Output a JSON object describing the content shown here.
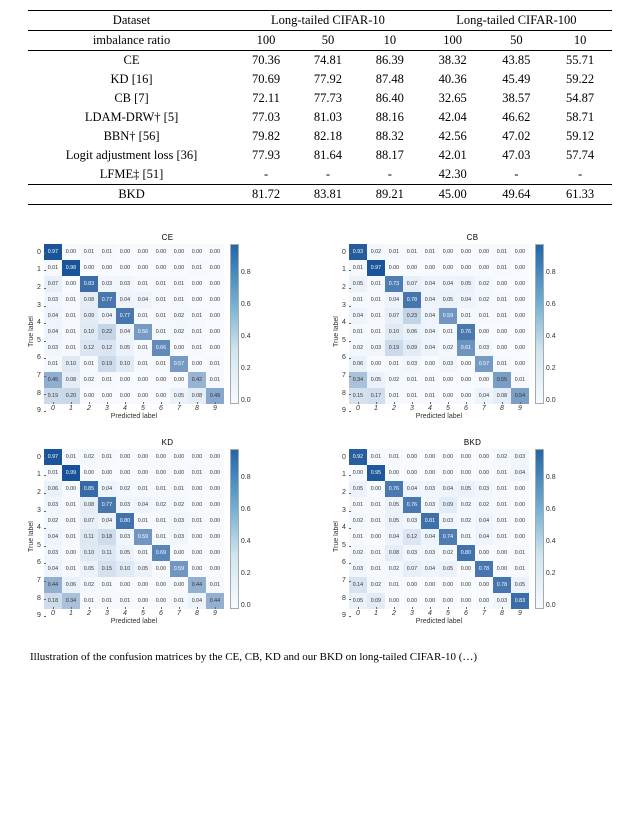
{
  "table": {
    "header1": {
      "dataset": "Dataset",
      "g10": "Long-tailed CIFAR-10",
      "g100": "Long-tailed CIFAR-100"
    },
    "header2": {
      "imb": "imbalance ratio",
      "c": [
        "100",
        "50",
        "10",
        "100",
        "50",
        "10"
      ]
    },
    "rows": [
      {
        "name": "CE",
        "v": [
          "70.36",
          "74.81",
          "86.39",
          "38.32",
          "43.85",
          "55.71"
        ]
      },
      {
        "name": "KD [16]",
        "v": [
          "70.69",
          "77.92",
          "87.48",
          "40.36",
          "45.49",
          "59.22"
        ]
      },
      {
        "name": "CB [7]",
        "v": [
          "72.11",
          "77.73",
          "86.40",
          "32.65",
          "38.57",
          "54.87"
        ]
      },
      {
        "name": "LDAM-DRW† [5]",
        "v": [
          "77.03",
          "81.03",
          "88.16",
          "42.04",
          "46.62",
          "58.71"
        ]
      },
      {
        "name": "BBN† [56]",
        "v": [
          "79.82",
          "82.18",
          "88.32",
          "42.56",
          "47.02",
          "59.12"
        ]
      },
      {
        "name": "Logit adjustment loss [36]",
        "v": [
          "77.93",
          "81.64",
          "88.17",
          "42.01",
          "47.03",
          "57.74"
        ]
      },
      {
        "name": "LFME‡ [51]",
        "v": [
          "-",
          "-",
          "-",
          "42.30",
          "-",
          "-"
        ]
      }
    ],
    "bkd": {
      "name": "BKD",
      "v": [
        "81.72",
        "83.81",
        "89.21",
        "45.00",
        "49.64",
        "61.33"
      ]
    }
  },
  "axis": {
    "ylabel": "True label",
    "xlabel": "Predicted label",
    "ticks": [
      "0",
      "1",
      "2",
      "3",
      "4",
      "5",
      "6",
      "7",
      "8",
      "9"
    ],
    "cbar_ticks_top": "",
    "cbar": [
      "",
      "0.8",
      "0.6",
      "0.4",
      "0.2",
      "0.0"
    ]
  },
  "chart_data": [
    {
      "type": "heatmap",
      "title": "CE",
      "xlabel": "Predicted label",
      "ylabel": "True label",
      "categories": [
        "0",
        "1",
        "2",
        "3",
        "4",
        "5",
        "6",
        "7",
        "8",
        "9"
      ],
      "values": [
        [
          0.97,
          0.0,
          0.01,
          0.01,
          0.0,
          0.0,
          0.0,
          0.0,
          0.0,
          0.0
        ],
        [
          0.01,
          0.98,
          0.0,
          0.0,
          0.0,
          0.0,
          0.0,
          0.0,
          0.01,
          0.0
        ],
        [
          0.07,
          0.0,
          0.83,
          0.03,
          0.03,
          0.01,
          0.01,
          0.01,
          0.0,
          0.0
        ],
        [
          0.03,
          0.01,
          0.08,
          0.77,
          0.04,
          0.04,
          0.01,
          0.01,
          0.0,
          0.0
        ],
        [
          0.04,
          0.01,
          0.09,
          0.04,
          0.77,
          0.01,
          0.01,
          0.02,
          0.01,
          0.0
        ],
        [
          0.04,
          0.01,
          0.1,
          0.22,
          0.04,
          0.56,
          0.01,
          0.02,
          0.01,
          0.0
        ],
        [
          0.03,
          0.01,
          0.12,
          0.12,
          0.05,
          0.01,
          0.66,
          0.0,
          0.01,
          0.0
        ],
        [
          0.01,
          0.1,
          0.01,
          0.19,
          0.1,
          0.01,
          0.01,
          0.57,
          0.0,
          0.01
        ],
        [
          0.45,
          0.08,
          0.02,
          0.01,
          0.0,
          0.0,
          0.0,
          0.0,
          0.42,
          0.01
        ],
        [
          0.19,
          0.2,
          0.0,
          0.0,
          0.0,
          0.0,
          0.0,
          0.05,
          0.08,
          0.49
        ]
      ]
    },
    {
      "type": "heatmap",
      "title": "CB",
      "xlabel": "Predicted label",
      "ylabel": "True label",
      "categories": [
        "0",
        "1",
        "2",
        "3",
        "4",
        "5",
        "6",
        "7",
        "8",
        "9"
      ],
      "values": [
        [
          0.93,
          0.02,
          0.01,
          0.01,
          0.01,
          0.0,
          0.0,
          0.0,
          0.01,
          0.0
        ],
        [
          0.01,
          0.97,
          0.0,
          0.0,
          0.0,
          0.0,
          0.0,
          0.0,
          0.01,
          0.0
        ],
        [
          0.05,
          0.01,
          0.73,
          0.07,
          0.04,
          0.04,
          0.05,
          0.02,
          0.0,
          0.0
        ],
        [
          0.01,
          0.01,
          0.04,
          0.78,
          0.04,
          0.05,
          0.04,
          0.02,
          0.01,
          0.0
        ],
        [
          0.04,
          0.01,
          0.07,
          0.23,
          0.04,
          0.59,
          0.01,
          0.01,
          0.01,
          0.0
        ],
        [
          0.01,
          0.01,
          0.1,
          0.06,
          0.04,
          0.01,
          0.76,
          0.0,
          0.0,
          0.0
        ],
        [
          0.02,
          0.03,
          0.19,
          0.09,
          0.04,
          0.02,
          0.61,
          0.03,
          0.0,
          0.0
        ],
        [
          0.06,
          0.0,
          0.01,
          0.03,
          0.0,
          0.03,
          0.0,
          0.57,
          0.01,
          0.0
        ],
        [
          0.34,
          0.05,
          0.02,
          0.01,
          0.01,
          0.0,
          0.0,
          0.0,
          0.55,
          0.01
        ],
        [
          0.15,
          0.17,
          0.01,
          0.01,
          0.01,
          0.0,
          0.0,
          0.04,
          0.08,
          0.54
        ]
      ]
    },
    {
      "type": "heatmap",
      "title": "KD",
      "xlabel": "Predicted label",
      "ylabel": "True label",
      "categories": [
        "0",
        "1",
        "2",
        "3",
        "4",
        "5",
        "6",
        "7",
        "8",
        "9"
      ],
      "values": [
        [
          0.97,
          0.01,
          0.02,
          0.01,
          0.0,
          0.0,
          0.0,
          0.0,
          0.0,
          0.0
        ],
        [
          0.01,
          0.99,
          0.0,
          0.0,
          0.0,
          0.0,
          0.0,
          0.0,
          0.01,
          0.0
        ],
        [
          0.06,
          0.0,
          0.85,
          0.04,
          0.02,
          0.01,
          0.01,
          0.01,
          0.0,
          0.0
        ],
        [
          0.03,
          0.01,
          0.08,
          0.77,
          0.03,
          0.04,
          0.02,
          0.02,
          0.0,
          0.0
        ],
        [
          0.02,
          0.01,
          0.07,
          0.04,
          0.8,
          0.01,
          0.01,
          0.03,
          0.01,
          0.0
        ],
        [
          0.04,
          0.01,
          0.11,
          0.18,
          0.03,
          0.59,
          0.01,
          0.03,
          0.0,
          0.0
        ],
        [
          0.03,
          0.0,
          0.1,
          0.11,
          0.05,
          0.01,
          0.69,
          0.0,
          0.0,
          0.0
        ],
        [
          0.04,
          0.01,
          0.05,
          0.15,
          0.1,
          0.05,
          0.0,
          0.59,
          0.0,
          0.0
        ],
        [
          0.44,
          0.06,
          0.02,
          0.01,
          0.0,
          0.0,
          0.0,
          0.0,
          0.44,
          0.01
        ],
        [
          0.18,
          0.34,
          0.01,
          0.01,
          0.01,
          0.0,
          0.0,
          0.01,
          0.04,
          0.44
        ]
      ]
    },
    {
      "type": "heatmap",
      "title": "BKD",
      "xlabel": "Predicted label",
      "ylabel": "True label",
      "categories": [
        "0",
        "1",
        "2",
        "3",
        "4",
        "5",
        "6",
        "7",
        "8",
        "9"
      ],
      "values": [
        [
          0.92,
          0.01,
          0.01,
          0.0,
          0.0,
          0.0,
          0.0,
          0.0,
          0.02,
          0.03
        ],
        [
          0.0,
          0.95,
          0.0,
          0.0,
          0.0,
          0.0,
          0.0,
          0.0,
          0.01,
          0.04
        ],
        [
          0.05,
          0.0,
          0.76,
          0.04,
          0.03,
          0.04,
          0.05,
          0.03,
          0.01,
          0.0
        ],
        [
          0.01,
          0.01,
          0.05,
          0.76,
          0.03,
          0.09,
          0.02,
          0.02,
          0.01,
          0.0
        ],
        [
          0.02,
          0.01,
          0.05,
          0.03,
          0.81,
          0.03,
          0.02,
          0.04,
          0.01,
          0.0
        ],
        [
          0.01,
          0.0,
          0.04,
          0.12,
          0.04,
          0.74,
          0.01,
          0.04,
          0.01,
          0.0
        ],
        [
          0.02,
          0.01,
          0.08,
          0.03,
          0.03,
          0.02,
          0.8,
          0.0,
          0.0,
          0.01
        ],
        [
          0.03,
          0.01,
          0.02,
          0.07,
          0.04,
          0.05,
          0.0,
          0.78,
          0.0,
          0.01
        ],
        [
          0.14,
          0.02,
          0.01,
          0.0,
          0.0,
          0.0,
          0.0,
          0.0,
          0.78,
          0.05
        ],
        [
          0.05,
          0.09,
          0.0,
          0.0,
          0.0,
          0.0,
          0.0,
          0.0,
          0.03,
          0.83
        ]
      ]
    }
  ],
  "caption": "Illustration of the confusion matrices by the CE, CB, KD and our BKD on long-tailed CIFAR-10 (…)"
}
